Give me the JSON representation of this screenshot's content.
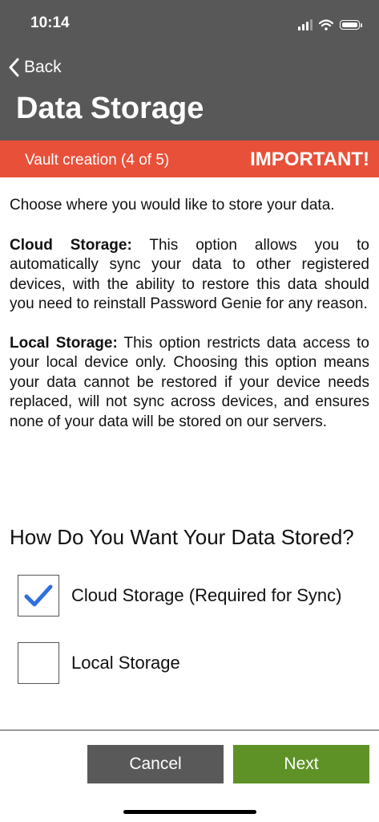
{
  "status_bar": {
    "time": "10:14"
  },
  "nav": {
    "back_label": "Back",
    "title": "Data Storage"
  },
  "banner": {
    "step": "Vault creation (4 of 5)",
    "important": "IMPORTANT!",
    "color": "#e8503a"
  },
  "intro": "Choose where you would like to store your data.",
  "cloud_info": {
    "heading": "Cloud Storage:",
    "text": " This option allows you to automatically sync your data to other registered devices, with the ability to restore this data should you need to reinstall Password Genie for any reason."
  },
  "local_info": {
    "heading": "Local Storage:",
    "text": " This option restricts data access to your local device only. Choosing this option means your data cannot be restored if your device needs replaced, will not sync across devices, and ensures none of your data will be stored on our servers."
  },
  "question": "How Do You Want Your Data Stored?",
  "options": [
    {
      "label": "Cloud Storage (Required for Sync)",
      "checked": true
    },
    {
      "label": "Local Storage",
      "checked": false
    }
  ],
  "buttons": {
    "cancel": "Cancel",
    "next": "Next"
  },
  "colors": {
    "header": "#585858",
    "check": "#2f6fe0",
    "cancel": "#595959",
    "next": "#5e9226"
  }
}
